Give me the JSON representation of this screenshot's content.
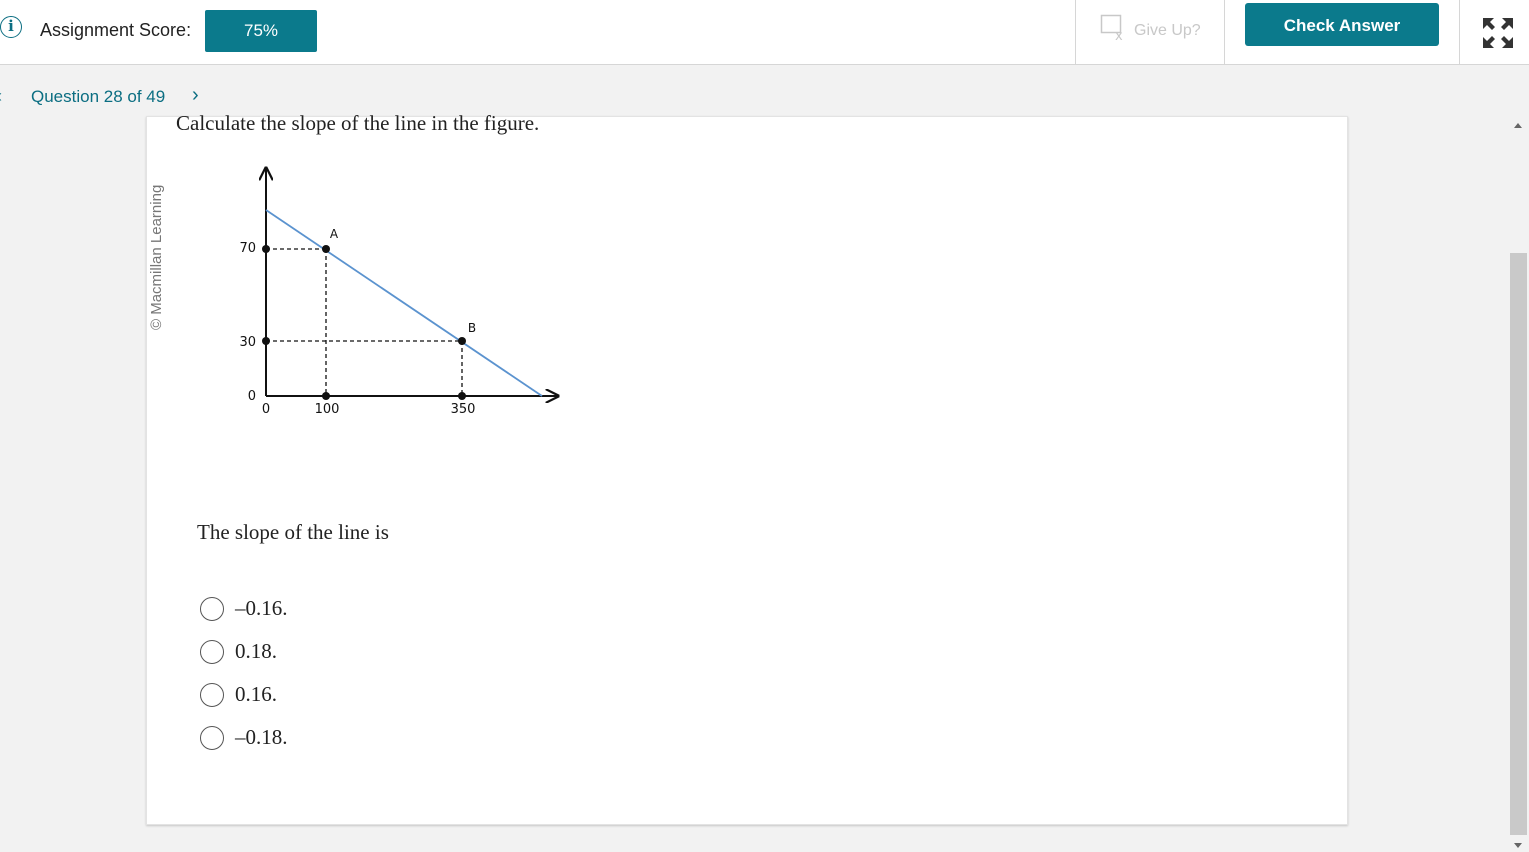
{
  "header": {
    "score_label": "Assignment Score:",
    "score_value": "75%",
    "give_up_label": "Give Up?",
    "check_answer_label": "Check Answer"
  },
  "nav": {
    "question_label": "Question 28 of 49",
    "prev_glyph": "‹",
    "next_glyph": "›"
  },
  "question": {
    "text": "Calculate the slope of the line in the figure.",
    "credit": "© Macmillan Learning",
    "prompt": "The slope of the line is",
    "options": [
      "–0.16.",
      "0.18.",
      "0.16.",
      "–0.18."
    ]
  },
  "figure": {
    "point_a_label": "A",
    "point_b_label": "B",
    "y_ticks": [
      "70",
      "30",
      "0"
    ],
    "x_ticks": [
      "0",
      "100",
      "350"
    ],
    "point_a": {
      "x": 100,
      "y": 70
    },
    "point_b": {
      "x": 350,
      "y": 30
    }
  },
  "colors": {
    "accent": "#0b7a8c",
    "line": "#5b93cf"
  },
  "icons": [
    "info-icon",
    "give-up-icon",
    "expand-icon",
    "chevron-left-icon",
    "chevron-right-icon"
  ]
}
